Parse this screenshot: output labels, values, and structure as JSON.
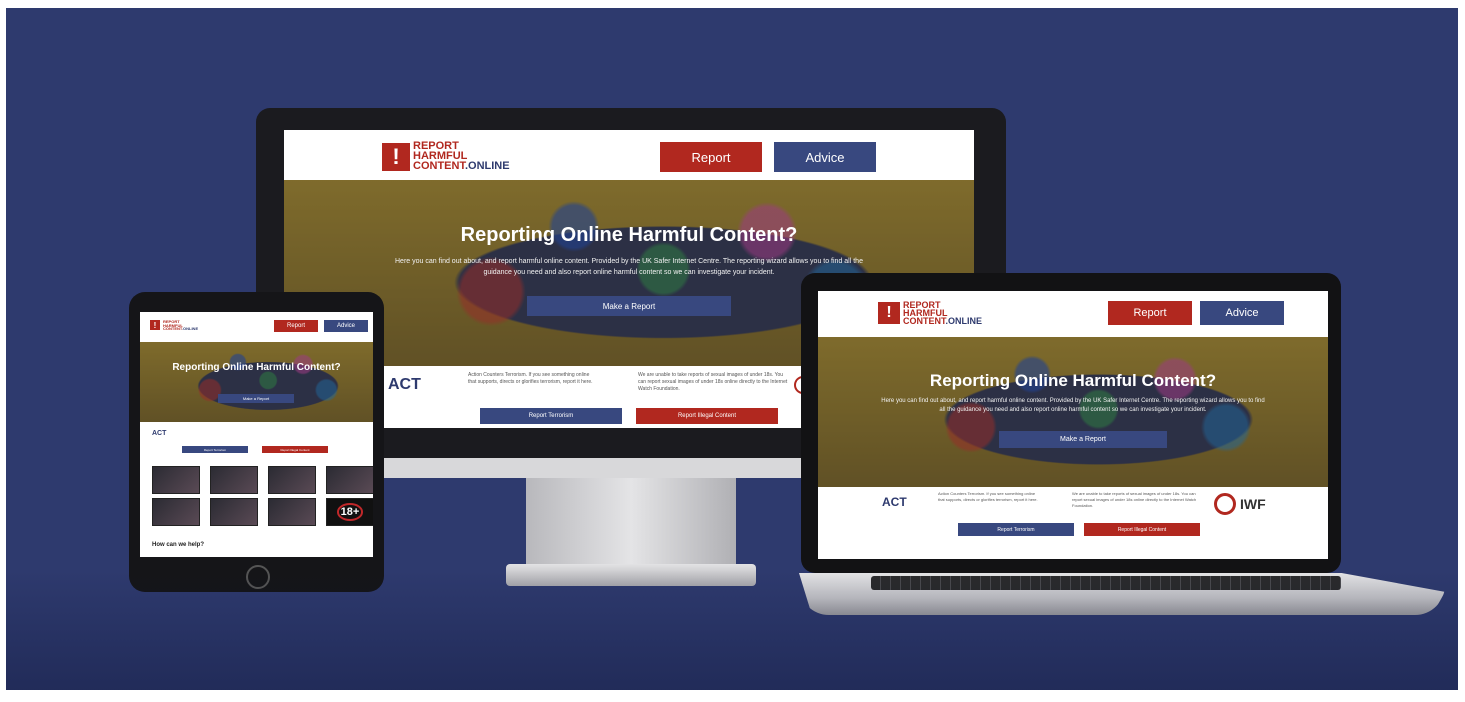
{
  "site": {
    "logo_mark": "!",
    "logo_line1": "REPORT",
    "logo_line2": "HARMFUL",
    "logo_line3": "CONTENT",
    "logo_suffix": ".ONLINE",
    "nav_report": "Report",
    "nav_advice": "Advice",
    "hero_title": "Reporting Online Harmful Content?",
    "hero_text": "Here you can find out about, and report harmful online content. Provided by the UK Safer Internet Centre. The reporting wizard allows you to find all the guidance you need and also report online harmful content so we can investigate your incident.",
    "hero_cta": "Make a Report",
    "act_logo": "ACT",
    "act_sub": "ACTION COUNTERS TERRORISM",
    "act_text": "Action Counters Terrorism. If you see something online that supports, directs or glorifies terrorism, report it here.",
    "iwf_text": "We are unable to take reports of sexual images of under 18s. You can report sexual images of under 18s online directly to the Internet Watch Foundation.",
    "iwf_logo": "IWF",
    "iwf_sub": "INTERNET WATCH FOUNDATION",
    "report_terrorism": "Report Terrorism",
    "report_illegal": "Report Illegal Content",
    "help_heading": "How can we help?",
    "rating": "18+"
  },
  "colors": {
    "background": "#2e3a6e",
    "brand_red": "#b1281f",
    "brand_blue": "#38487f"
  }
}
